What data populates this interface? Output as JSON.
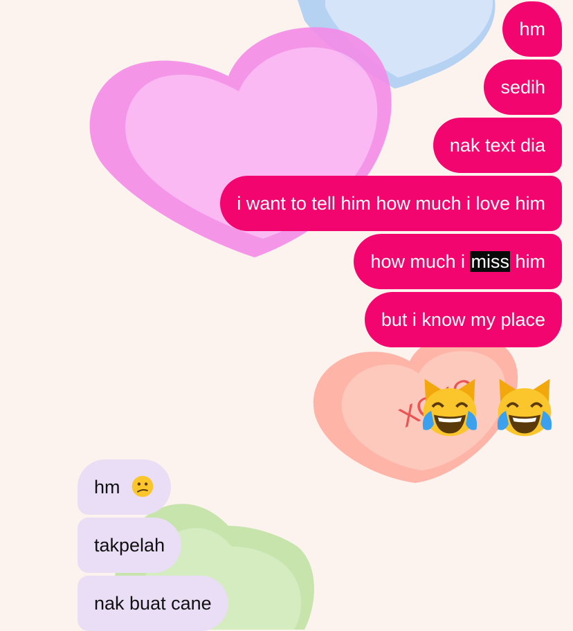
{
  "messages_sent": [
    {
      "text": "hm"
    },
    {
      "text": "sedih"
    },
    {
      "text": "nak text dia"
    },
    {
      "text": "i want to tell him how much i love him"
    },
    {
      "before": "how much i ",
      "highlight": "miss",
      "after": " him"
    },
    {
      "text": "but i know my place"
    }
  ],
  "sent_reaction": {
    "emojis": [
      "cat-tears-of-joy-icon",
      "cat-tears-of-joy-icon"
    ]
  },
  "background_heart_text": "XOXO",
  "messages_received": [
    {
      "text": "hm",
      "emoji": "confused-face-icon"
    },
    {
      "text": "takpelah"
    },
    {
      "text": "nak buat cane"
    }
  ],
  "colors": {
    "sent_bubble": "#f2056f",
    "received_bubble": "#e9def5",
    "background": "#fcf2ee"
  }
}
